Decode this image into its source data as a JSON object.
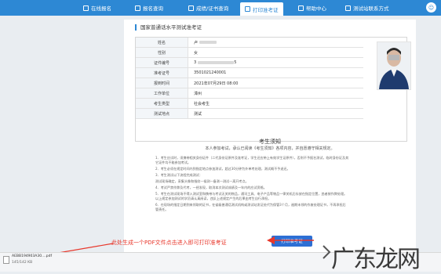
{
  "nav": {
    "tabs": [
      {
        "label": "在线报名",
        "icon": "edit-icon"
      },
      {
        "label": "报名查询",
        "icon": "search-icon"
      },
      {
        "label": "成绩/证书查询",
        "icon": "certificate-icon"
      },
      {
        "label": "打印准考证",
        "icon": "print-icon"
      },
      {
        "label": "帮助中心",
        "icon": "help-icon"
      },
      {
        "label": "测试站联系方式",
        "icon": "contact-icon"
      }
    ],
    "active_tab": "打印准考证",
    "user_icon": "user-icon"
  },
  "section_title": "国家普通话水平测试准考证",
  "info": {
    "rows": [
      {
        "label": "姓名",
        "value": "卢"
      },
      {
        "label": "性别",
        "value": "女"
      },
      {
        "label": "证件编号",
        "value": "3",
        "value_tail": "5"
      },
      {
        "label": "准考证号",
        "value": "3501021240001"
      },
      {
        "label": "报到时间",
        "value": "2021年07月29日 08:00"
      },
      {
        "label": "工作单位",
        "value": "漳州"
      },
      {
        "label": "考生类型",
        "value": "社会考生"
      },
      {
        "label": "测试地点",
        "value": "测试"
      }
    ],
    "photo_icon": "avatar-photo"
  },
  "notice": {
    "title": "考生须知",
    "subtitle": "本人参加考试，承认已阅读《考生须知》各项内容，并自愿遵守相关规定。",
    "lines": [
      "1．考生应试时，须携带相关身份证件（二代身份证原件及准考证，学生还应带上有效学生证原件），否则不予报名测试，临时身份证及其",
      "它证件均不能参加考试。",
      "2．考生必须在规定时间内到指定地点参加测试，超过30分钟为外单考处理，测试概不予退还。",
      "3．考生测试以下流程完成测试：",
      "测试现场确定，采集头像和指纹—候测—备测—测试—离开考点。",
      "4．考试严禁作弊及代考，一经发现，取消本次测试成绩及一年内的应试资格。",
      "5．考生在测试现场不得入测试室和携带与考试无关的物品，通讯工具、电子产品等物品一律关机后存放在指定位置，违者按作弊处理。",
      "以上规定参加测试的学员请认真阅读，违反上述规定产生的后果由考生自行承担。",
      "6．在现场的指定日期到来领取的证书，在省级普通话测试机构或测试站发证处代为保管3个月，逾期未领的作废处理证书，不再承担后",
      "管责任。"
    ]
  },
  "print_button": "打印准考证",
  "annotation": "此处生成一个PDF文件点击进入即可打印准考证",
  "download": {
    "file_name": "AEBB194903A30....pdf",
    "file_size": "145/142 KB"
  },
  "watermark": "广东龙网"
}
